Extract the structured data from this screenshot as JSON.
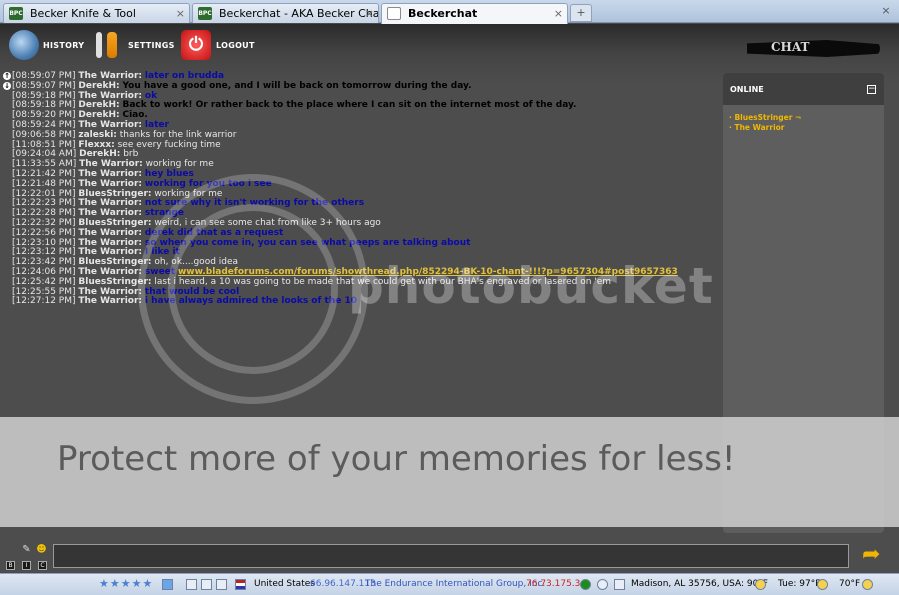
{
  "browser": {
    "tabs": [
      {
        "label": "Becker Knife & Tool",
        "favicon": "BPC"
      },
      {
        "label": "Beckerchat - AKA Becker Chatroom",
        "favicon": "BPC"
      },
      {
        "label": "Beckerchat",
        "favicon": ""
      }
    ],
    "new_tab_label": "+",
    "close_label": "×"
  },
  "toolbar": {
    "history_label": "HISTORY",
    "settings_label": "SETTINGS",
    "logout_label": "LOGOUT",
    "logo_text": "CHAT"
  },
  "messages": [
    {
      "time": "[08:59:07 PM]",
      "nick": "The Warrior:",
      "text": "later on brudda",
      "style": "t-navy",
      "arrow": "up"
    },
    {
      "time": "[08:59:07 PM]",
      "nick": "DerekH:",
      "text": "You have a good one, and I will be back on tomorrow during the day.",
      "style": "t-black",
      "arrow": "down"
    },
    {
      "time": "[08:59:18 PM]",
      "nick": "The Warrior:",
      "text": "ok",
      "style": "t-navy"
    },
    {
      "time": "[08:59:18 PM]",
      "nick": "DerekH:",
      "text": "Back to work! Or rather back to the place where I can sit on the internet most of the day.",
      "style": "t-black"
    },
    {
      "time": "[08:59:20 PM]",
      "nick": "DerekH:",
      "text": "Ciao.",
      "style": "t-black"
    },
    {
      "time": "[08:59:24 PM]",
      "nick": "The Warrior:",
      "text": "later",
      "style": "t-navy"
    },
    {
      "time": "[09:06:58 PM]",
      "nick": "zaleski:",
      "text": "thanks for the link warrior",
      "style": "t-light"
    },
    {
      "time": "[11:08:51 PM]",
      "nick": "Flexxx:",
      "text": "see every fucking time",
      "style": "t-light"
    },
    {
      "time": "[09:24:04 AM]",
      "nick": "DerekH:",
      "text": "brb",
      "style": "t-light"
    },
    {
      "time": "[11:33:55 AM]",
      "nick": "The Warrior:",
      "text": "working for me",
      "style": "t-light"
    },
    {
      "time": "[12:21:42 PM]",
      "nick": "The Warrior:",
      "text": "hey blues",
      "style": "t-navy"
    },
    {
      "time": "[12:21:48 PM]",
      "nick": "The Warrior:",
      "text": "working for you too i see",
      "style": "t-navy"
    },
    {
      "time": "[12:22:01 PM]",
      "nick": "BluesStringer:",
      "text": "working for me",
      "style": "t-light"
    },
    {
      "time": "[12:22:23 PM]",
      "nick": "The Warrior:",
      "text": "not sure why it isn't working for the others",
      "style": "t-navy"
    },
    {
      "time": "[12:22:28 PM]",
      "nick": "The Warrior:",
      "text": "strange",
      "style": "t-navy"
    },
    {
      "time": "[12:22:32 PM]",
      "nick": "BluesStringer:",
      "text": "weird, i can see some chat from like 3+ hours ago",
      "style": "t-light"
    },
    {
      "time": "[12:22:56 PM]",
      "nick": "The Warrior:",
      "text": "derek did that as a request",
      "style": "t-navy"
    },
    {
      "time": "[12:23:10 PM]",
      "nick": "The Warrior:",
      "text": "so when you come in, you can see what peeps are talking about",
      "style": "t-navy"
    },
    {
      "time": "[12:23:12 PM]",
      "nick": "The Warrior:",
      "text": "I like it",
      "style": "t-navy"
    },
    {
      "time": "[12:23:42 PM]",
      "nick": "BluesStringer:",
      "text": "oh, ok....good idea",
      "style": "t-light"
    },
    {
      "time": "[12:24:06 PM]",
      "nick": "The Warrior:",
      "text": "sweet",
      "link": "www.bladeforums.com/forums/showthread.php/852294-BK-10-chant-!!!?p=9657304#post9657363",
      "style": "t-navy"
    },
    {
      "time": "[12:25:42 PM]",
      "nick": "BluesStringer:",
      "text": "last i heard, a 10 was going to be made that we could get with our BHA's engraved or lasered on 'em",
      "style": "t-light"
    },
    {
      "time": "[12:25:55 PM]",
      "nick": "The Warrior:",
      "text": "that would be cool",
      "style": "t-navy"
    },
    {
      "time": "[12:27:12 PM]",
      "nick": "The Warrior:",
      "text": "i have always admired the looks of the 10",
      "style": "t-navy"
    }
  ],
  "online": {
    "title": "ONLINE",
    "toggle": "−",
    "users": [
      "· BluesStringer ¬",
      "· The Warrior"
    ]
  },
  "watermark": {
    "logo_text": "photobucket",
    "banner_text": "Protect more of your memories for less!"
  },
  "input": {
    "placeholder": "",
    "buttons": [
      "B",
      "I",
      "C"
    ]
  },
  "statusbar": {
    "rating": "★★★★★",
    "country": "United States",
    "ip": "66.96.147.113",
    "isp": "The Endurance International Group, Inc.",
    "ip2": "76.73.175.34",
    "weather": "Madison, AL 35756, USA: 90°F",
    "forecast": "Tue: 97°F",
    "temp": "70°F"
  }
}
